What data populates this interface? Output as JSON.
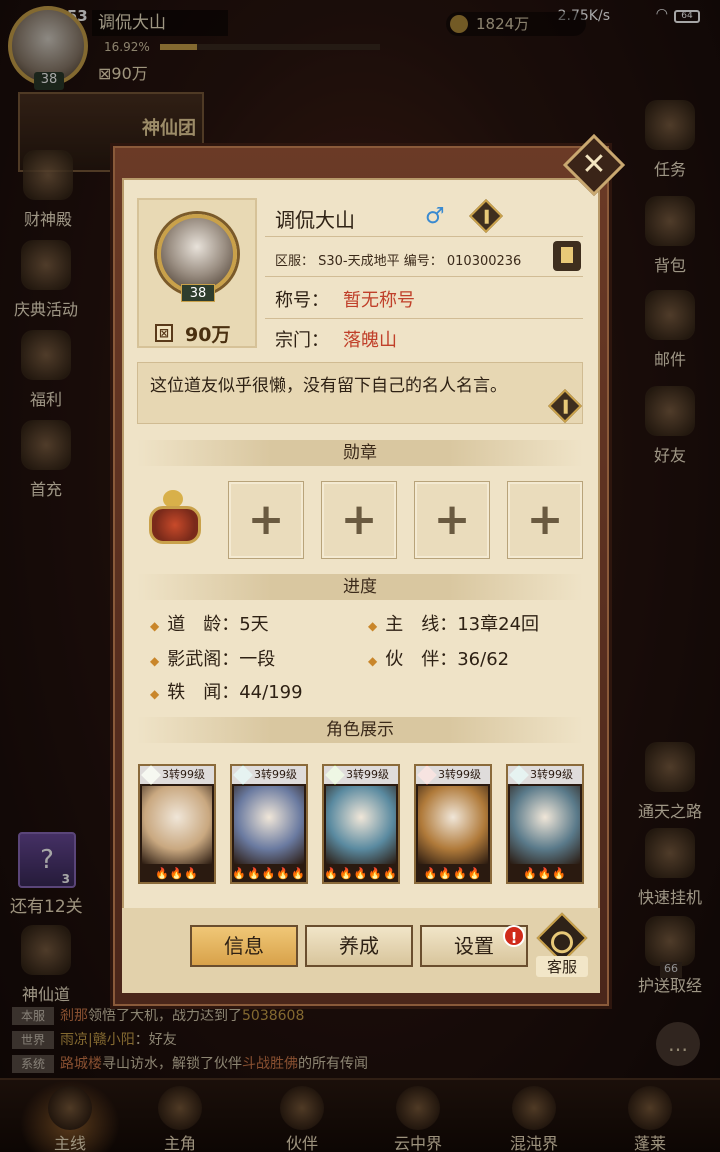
{
  "status_bar": {
    "time": "12:53",
    "net_speed": "2.75K/s",
    "battery": "64"
  },
  "hud": {
    "player_name": "调侃大山",
    "exp_percent_text": "16.92%",
    "exp_fraction": 0.1692,
    "level": "38",
    "power": "90万",
    "currency": "1824万",
    "team_label": "神仙团"
  },
  "side_left": [
    "财神殿",
    "庆典活动",
    "福利",
    "首充"
  ],
  "side_right": [
    "任务",
    "背包",
    "邮件",
    "好友",
    "通天之路",
    "快速挂机",
    "护送取经"
  ],
  "left_extra": {
    "card_count": "3",
    "remaining": "还有12关",
    "path": "神仙道"
  },
  "chat": [
    {
      "tag": "本服",
      "pre": "剎那",
      "mid": "领悟了大机，战力达到了",
      "post": "5038608"
    },
    {
      "tag": "世界",
      "pre": "雨凉|赣小阳",
      "mid": "：好友",
      "post": ""
    },
    {
      "tag": "系统",
      "pre": "路城楼",
      "mid": "寻山访水，解锁了伙伴",
      "post": "斗战胜佛",
      "tail": "的所有传闻"
    }
  ],
  "bottom_nav": [
    "主线",
    "主角",
    "伙伴",
    "云中界",
    "混沌界",
    "蓬莱"
  ],
  "badge_66": "66",
  "profile": {
    "close": "✕",
    "name": "调侃大山",
    "gender": "♂",
    "level": "38",
    "power": "90万",
    "server_line": "区服： S30-天成地平  编号： 010300236",
    "title_label": "称号：",
    "title_value": "暂无称号",
    "sect_label": "宗门：",
    "sect_value": "落魄山",
    "motto": "这位道友似乎很懒，没有留下自己的名人名言。",
    "medals_header": "勋章",
    "medal_slots": [
      "+",
      "+",
      "+",
      "+"
    ],
    "progress_header": "进度",
    "progress": [
      {
        "label": "道　龄：",
        "value": "5天"
      },
      {
        "label": "主　线：",
        "value": "13章24回"
      },
      {
        "label": "影武阁：",
        "value": "一段"
      },
      {
        "label": "伙　伴：",
        "value": "36/62"
      },
      {
        "label": "轶　闻：",
        "value": "44/199"
      }
    ],
    "showcase_header": "角色展示",
    "heroes": [
      {
        "rank": "3转99级",
        "color": "#c4d0a0",
        "stars": "🔥🔥🔥",
        "bg": "#c9a880"
      },
      {
        "rank": "3转99级",
        "color": "#5ab0a0",
        "stars": "🔥🔥🔥🔥🔥",
        "bg": "#6a7aa0"
      },
      {
        "rank": "3转99级",
        "color": "#8ac84a",
        "stars": "🔥🔥🔥🔥🔥",
        "bg": "#5a8aa0"
      },
      {
        "rank": "3转99级",
        "color": "#c84a3a",
        "stars": "🔥🔥🔥🔥",
        "bg": "#b07a3a"
      },
      {
        "rank": "3转99级",
        "color": "#5ab0a0",
        "stars": "🔥🔥🔥",
        "bg": "#5a7a8a"
      }
    ],
    "buttons": {
      "info": "信息",
      "train": "养成",
      "settings": "设置",
      "service": "客服",
      "alert": "!"
    }
  }
}
